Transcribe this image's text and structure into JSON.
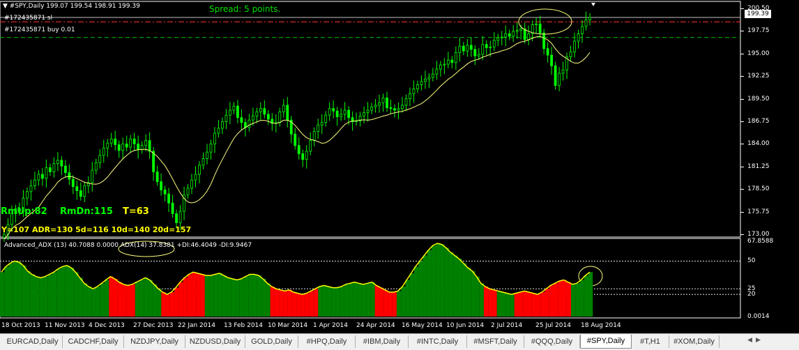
{
  "main": {
    "symbol_line": "#SPY,Daily  199.07 199.54 198.91 199.39",
    "spread": "Spread: 5 points.",
    "order_sl": "#172435871 sl",
    "order_buy": "#172435871 buy 0.01",
    "price_badge": "199.39",
    "y_labels": [
      "200.50",
      "197.75",
      "195.00",
      "192.25",
      "189.50",
      "186.75",
      "184.00",
      "181.25",
      "178.50",
      "175.75",
      "173.00"
    ],
    "hud_line1": {
      "up": "RmUp:82",
      "dn": "RmDn:115",
      "t": "T=63"
    },
    "hud_line2": "Y=107  ADR=130  5d=116  10d=140  20d=157"
  },
  "indicator": {
    "title": "Advanced_ADX (13) 40.7088 0.0000  ADX(14) 37.8381 +DI:46.4049 -DI:9.9467",
    "y_labels": [
      "67.8588",
      "50",
      "25",
      "20",
      "0.0014"
    ]
  },
  "x_labels": [
    "18 Oct 2013",
    "11 Nov 2013",
    "4 Dec 2013",
    "27 Dec 2013",
    "22 Jan 2014",
    "13 Feb 2014",
    "10 Mar 2014",
    "1 Apr 2014",
    "24 Apr 2014",
    "16 May 2014",
    "10 Jun 2014",
    "2 Jul 2014",
    "25 Jul 2014",
    "18 Aug 2014"
  ],
  "tabs": [
    "EURCAD,Daily",
    "CADCHF,Daily",
    "NZDJPY,Daily",
    "NZDUSD,Daily",
    "GOLD,Daily",
    "#HPQ,Daily",
    "#IBM,Daily",
    "#INTC,Daily",
    "#MSFT,Daily",
    "#QQQ,Daily",
    "#SPY,Daily",
    "#T,H1",
    "#XOM,Daily"
  ],
  "active_tab": "#SPY,Daily",
  "chart_data": {
    "type": "candlestick",
    "price_closes": [
      173.0,
      174.2,
      175.5,
      176.1,
      175.8,
      177.4,
      178.2,
      178.9,
      179.6,
      180.3,
      179.8,
      181.1,
      180.6,
      181.6,
      182.0,
      181.3,
      180.5,
      179.7,
      178.8,
      178.3,
      177.6,
      178.9,
      179.3,
      180.8,
      181.7,
      182.6,
      183.5,
      184.1,
      184.6,
      183.9,
      183.2,
      184.0,
      183.6,
      184.6,
      184.0,
      183.3,
      183.8,
      184.4,
      183.1,
      180.6,
      179.4,
      178.4,
      177.9,
      176.8,
      175.5,
      174.4,
      175.8,
      177.8,
      178.6,
      179.6,
      180.3,
      181.4,
      182.2,
      183.0,
      184.0,
      185.3,
      185.9,
      186.7,
      187.5,
      188.1,
      188.6,
      187.2,
      186.6,
      186.0,
      186.9,
      187.4,
      187.9,
      188.3,
      187.6,
      187.0,
      186.5,
      186.6,
      187.9,
      188.7,
      186.9,
      185.2,
      183.8,
      182.8,
      182.1,
      183.1,
      184.4,
      185.5,
      186.3,
      186.6,
      187.5,
      188.3,
      188.0,
      187.3,
      187.6,
      188.1,
      187.2,
      186.7,
      186.8,
      187.4,
      187.8,
      188.1,
      188.5,
      188.7,
      189.0,
      189.6,
      188.4,
      188.3,
      188.1,
      188.3,
      188.7,
      189.5,
      190.1,
      190.7,
      191.2,
      191.6,
      191.9,
      192.1,
      192.5,
      193.1,
      193.6,
      193.7,
      194.2,
      193.9,
      195.1,
      195.9,
      195.3,
      196.0,
      195.5,
      194.7,
      194.9,
      196.1,
      195.7,
      195.8,
      196.6,
      196.9,
      197.0,
      197.4,
      197.1,
      197.7,
      197.8,
      198.0,
      196.7,
      197.4,
      198.5,
      198.6,
      197.5,
      195.6,
      194.8,
      193.5,
      191.1,
      192.6,
      193.0,
      194.6,
      195.2,
      196.5,
      197.4,
      198.3,
      199.1,
      199.4
    ],
    "adx_values": [
      40,
      45,
      48,
      50,
      49,
      46,
      41,
      38,
      36,
      35,
      36,
      38,
      40,
      43,
      45,
      46,
      44,
      40,
      35,
      30,
      27,
      25,
      27,
      30,
      33,
      36,
      34,
      31,
      29,
      28,
      29,
      31,
      33,
      35,
      33,
      29,
      25,
      22,
      20,
      22,
      26,
      31,
      35,
      38,
      40,
      39,
      38,
      37,
      37,
      38,
      39,
      37,
      35,
      34,
      33,
      34,
      36,
      38,
      38,
      37,
      34,
      30,
      27,
      25,
      24,
      23,
      24,
      22,
      21,
      20,
      21,
      23,
      25,
      27,
      28,
      27,
      26,
      26,
      27,
      29,
      30,
      31,
      30,
      29,
      30,
      31,
      28,
      26,
      24,
      22,
      22,
      23,
      27,
      33,
      39,
      45,
      50,
      55,
      60,
      64,
      66,
      65,
      62,
      58,
      55,
      52,
      48,
      44,
      41,
      36,
      30,
      27,
      25,
      24,
      23,
      22,
      21,
      20,
      21,
      22,
      23,
      22,
      21,
      20,
      22,
      25,
      28,
      30,
      32,
      33,
      31,
      29,
      30,
      33,
      37,
      40
    ]
  }
}
